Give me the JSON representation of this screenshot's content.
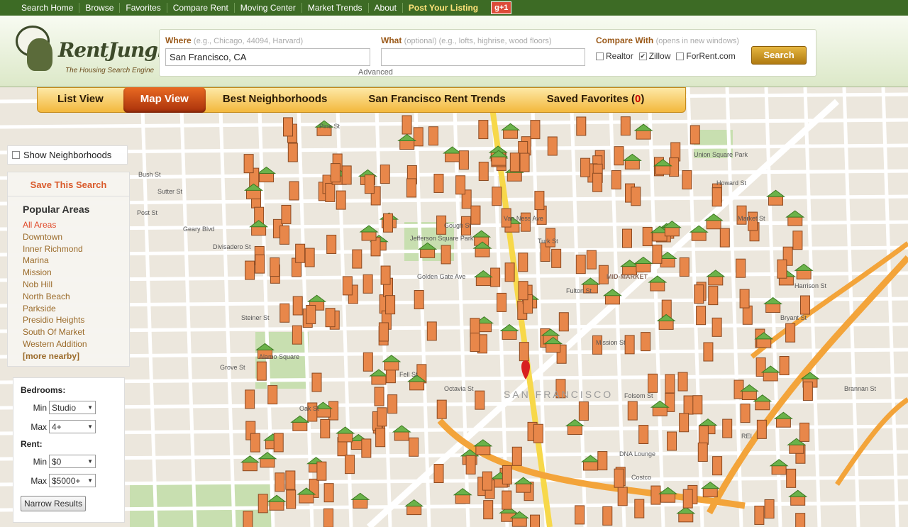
{
  "topnav": {
    "items": [
      "Search Home",
      "Browse",
      "Favorites",
      "Compare Rent",
      "Moving Center",
      "Market Trends",
      "About"
    ],
    "post_listing": "Post Your Listing",
    "gplus": "g+1"
  },
  "logo": {
    "name": "RentJungle.com",
    "tm": "™",
    "tagline": "The Housing Search Engine"
  },
  "search": {
    "where_label": "Where",
    "where_hint": "(e.g., Chicago, 44094, Harvard)",
    "where_value": "San Francisco, CA",
    "what_label": "What",
    "what_hint": "(optional) (e.g., lofts, highrise, wood floors)",
    "what_value": "",
    "advanced": "Advanced",
    "compare_label": "Compare With",
    "compare_hint": "(opens in new windows)",
    "compare_options": [
      {
        "label": "Realtor",
        "checked": false
      },
      {
        "label": "Zillow",
        "checked": true
      },
      {
        "label": "ForRent.com",
        "checked": false
      }
    ],
    "button": "Search"
  },
  "tabs": {
    "list": "List View",
    "map": "Map View",
    "neighborhoods": "Best Neighborhoods",
    "trends": "San Francisco Rent Trends",
    "favorites": "Saved Favorites (",
    "favorites_count": "0",
    "favorites_close": ")"
  },
  "sidebar": {
    "show_neighborhoods": "Show Neighborhoods",
    "save_search": "Save This Search",
    "popular_title": "Popular Areas",
    "areas": [
      "All Areas",
      "Downtown",
      "Inner Richmond",
      "Marina",
      "Mission",
      "Nob Hill",
      "North Beach",
      "Parkside",
      "Presidio Heights",
      "South Of Market",
      "Western Addition"
    ],
    "more_nearby": "[more nearby]"
  },
  "filters": {
    "bedrooms_label": "Bedrooms:",
    "min_label": "Min",
    "max_label": "Max",
    "bed_min": "Studio",
    "bed_max": "4+",
    "rent_label": "Rent:",
    "rent_min": "$0",
    "rent_max": "$5000+",
    "narrow_button": "Narrow Results"
  },
  "map": {
    "labels": [
      "Pine St",
      "Geary Blvd",
      "Bush St",
      "Sutter St",
      "Post St",
      "Turk St",
      "Golden Gate Ave",
      "Fulton St",
      "Grove St",
      "Fell St",
      "Oak St",
      "Market St",
      "Mission St",
      "Folsom St",
      "Van Ness Ave",
      "Gough St",
      "Octavia St",
      "Divisadero St",
      "Steiner St",
      "MID-MARKET",
      "SAN FRANCISCO",
      "Bryant St",
      "Harrison St",
      "Howard St",
      "Brannan St",
      "Costco",
      "REI",
      "DNA Lounge",
      "Jefferson Square Park",
      "Alamo Square",
      "Union Square Park"
    ]
  }
}
